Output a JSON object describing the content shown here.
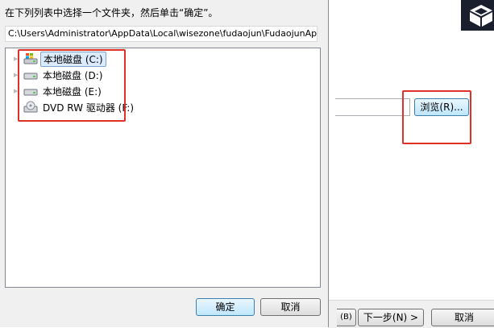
{
  "dialog": {
    "instruction": "在下列列表中选择一个文件夹，然后单击“确定”。",
    "folder_path": "C:\\Users\\Administrator\\AppData\\Local\\wisezone\\fudaojun\\FudaojunApp",
    "tree": [
      {
        "label": "本地磁盘 (C:)",
        "icon": "system-drive-icon",
        "selected": true
      },
      {
        "label": "本地磁盘 (D:)",
        "icon": "hard-drive-icon",
        "selected": false
      },
      {
        "label": "本地磁盘 (E:)",
        "icon": "hard-drive-icon",
        "selected": false
      },
      {
        "label": "DVD RW 驱动器 (F:)",
        "icon": "dvd-drive-icon",
        "selected": false
      }
    ],
    "ok_label": "确定",
    "cancel_label": "取消"
  },
  "wizard": {
    "browse_label": "浏览(R)...",
    "back_label": "(B)",
    "next_label": "下一步(N) >",
    "cancel_label": "取消"
  },
  "colors": {
    "annotation": "#e0302a",
    "selection": "#dcebfc",
    "dialog_bg": "#f0f0f0"
  }
}
